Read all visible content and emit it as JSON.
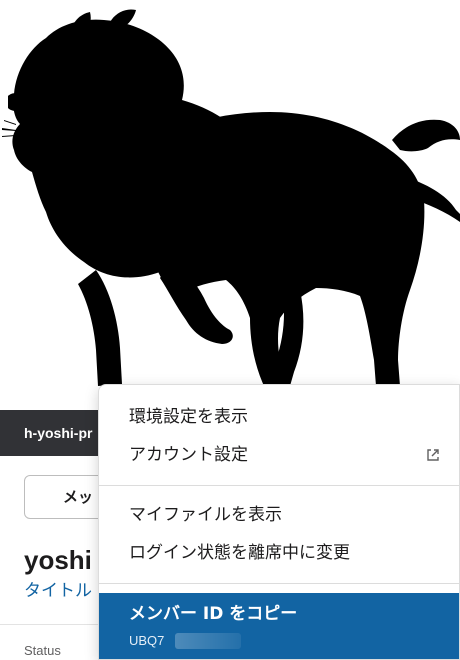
{
  "profile": {
    "handle": "h-yoshi-pr",
    "message_button_label": "メッ",
    "display_name": "yoshi",
    "title_link": "タイトル",
    "status_label": "Status"
  },
  "context_menu": {
    "items": [
      {
        "label": "環境設定を表示"
      },
      {
        "label": "アカウント設定",
        "icon": "external-link-icon"
      },
      {
        "label": "マイファイルを表示"
      },
      {
        "label": "ログイン状態を離席中に変更"
      }
    ],
    "highlighted": {
      "label": "メンバー ID をコピー",
      "member_id_prefix": "UBQ7"
    }
  },
  "colors": {
    "accent": "#1264a3",
    "handle_bg": "#313236",
    "text": "#1d1c1d"
  }
}
